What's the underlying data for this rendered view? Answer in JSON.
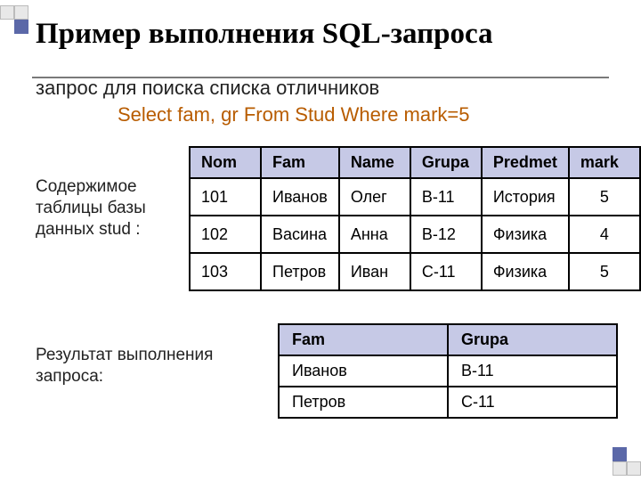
{
  "chart_data": {
    "type": "table",
    "title": "Пример выполнения SQL-запроса",
    "note": "запрос для поиска списка отличников",
    "sql": "Select fam, gr  From Stud  Where mark=5",
    "source_table": {
      "caption": "Содержимое таблицы базы данных stud :",
      "headers": [
        "Nom",
        "Fam",
        "Name",
        "Grupa",
        "Predmet",
        "mark"
      ],
      "rows": [
        [
          "101",
          "Иванов",
          "Олег",
          "В-11",
          "История",
          "5"
        ],
        [
          "102",
          "Васина",
          "Анна",
          "В-12",
          "Физика",
          "4"
        ],
        [
          "103",
          "Петров",
          "Иван",
          "С-11",
          "Физика",
          "5"
        ]
      ]
    },
    "result_table": {
      "caption": "Результат выполнения запроса:",
      "headers": [
        "Fam",
        "Grupa"
      ],
      "rows": [
        [
          "Иванов",
          "В-11"
        ],
        [
          "Петров",
          "С-11"
        ]
      ]
    }
  }
}
